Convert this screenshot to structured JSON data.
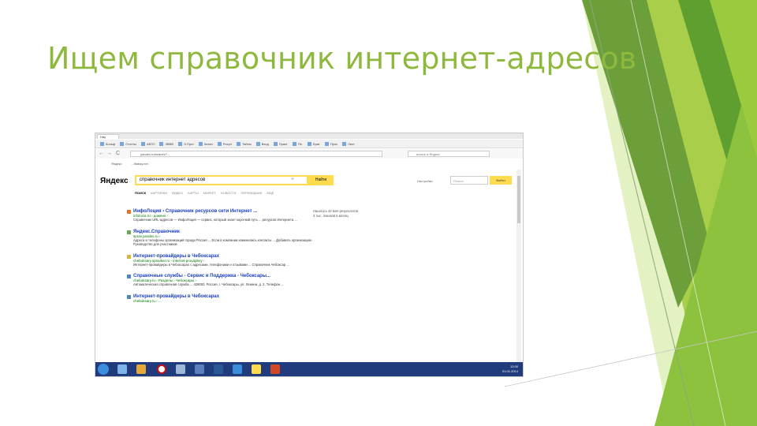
{
  "slide": {
    "title": "Ищем справочник интернет-адресов"
  },
  "browser": {
    "tab_label": "Нау",
    "bookmarks": [
      "Кольф",
      "Отчеты",
      "АВТО",
      "ЗВВВ",
      "Э.Прот",
      "Катал",
      "Рисун",
      "Тайны",
      "Вход",
      "Практ",
      "Пе.",
      "Брат",
      "Прос",
      "Лист"
    ],
    "address_url": "yandex.ru/search/?...",
    "search_placeholder": "искать в Яндекс",
    "bookmarks2": [
      "Яндекс",
      "...ifiabay.net"
    ],
    "nav_back": "←",
    "nav_forward": "→",
    "nav_reload": "C"
  },
  "yandex": {
    "logo": "Яндекс",
    "query": "справочник интернет адресов",
    "clear": "×",
    "search_button": "Найти",
    "settings": "Настройки",
    "region_placeholder": "Регион",
    "login_button": "Войти",
    "tabs": [
      "ПОИСК",
      "КАРТИНКИ",
      "ВИДЕО",
      "КАРТЫ",
      "МАРКЕТ",
      "НОВОСТИ",
      "ПЕРЕВОДЧИК",
      "ЕЩЁ"
    ],
    "side_note": "Нашлось 42 млн результатов\n3 тыс. показов в месяц"
  },
  "results": [
    {
      "title": "ИнфоЛоция › Справочник ресурсов сети Интернет ...",
      "url": "infolocia.ru › доменs ›",
      "snippet": "Справочник URL-адресов — ИнфоЛоция — сервис, который знает короткий путь ... ресурсов Интернета ..."
    },
    {
      "title": "Яндекс.Справочник",
      "url": "sprav.yandex.ru ›",
      "snippet": "Адреса и телефоны организаций города Россия ... Если в компании изменились контакты ... Добавить организацию · Руководство для участников"
    },
    {
      "title": "Интернет-провайдеры в Чебоксарах",
      "url": "cheboksary.spravker.ru › internet-provajdery ›",
      "snippet": "Интернет-провайдеры в Чебоксарах с адресами, телефонами и отзывами ... Справочник Чебоксар ..."
    },
    {
      "title": "Справочные службы - Сервис и Поддержка - Чебоксары...",
      "url": "cheboksary.ru › Разделы › Чебоксары ›",
      "snippet": "Автоматическая справочная служба ... 428000, Россия, г. Чебоксары, ул. Ленина, д. 2, Телефон ..."
    },
    {
      "title": "Интернет-провайдеры в Чебоксарах",
      "url": "cheboksary.ru › ...",
      "snippet": ""
    }
  ],
  "taskbar": {
    "tray_time": "12:00",
    "tray_date": "01.01.2014"
  },
  "colors": {
    "title": "#8fb83e",
    "yandex_yellow": "#ffdb4d",
    "link": "#1a3dc1",
    "url": "#007700"
  }
}
